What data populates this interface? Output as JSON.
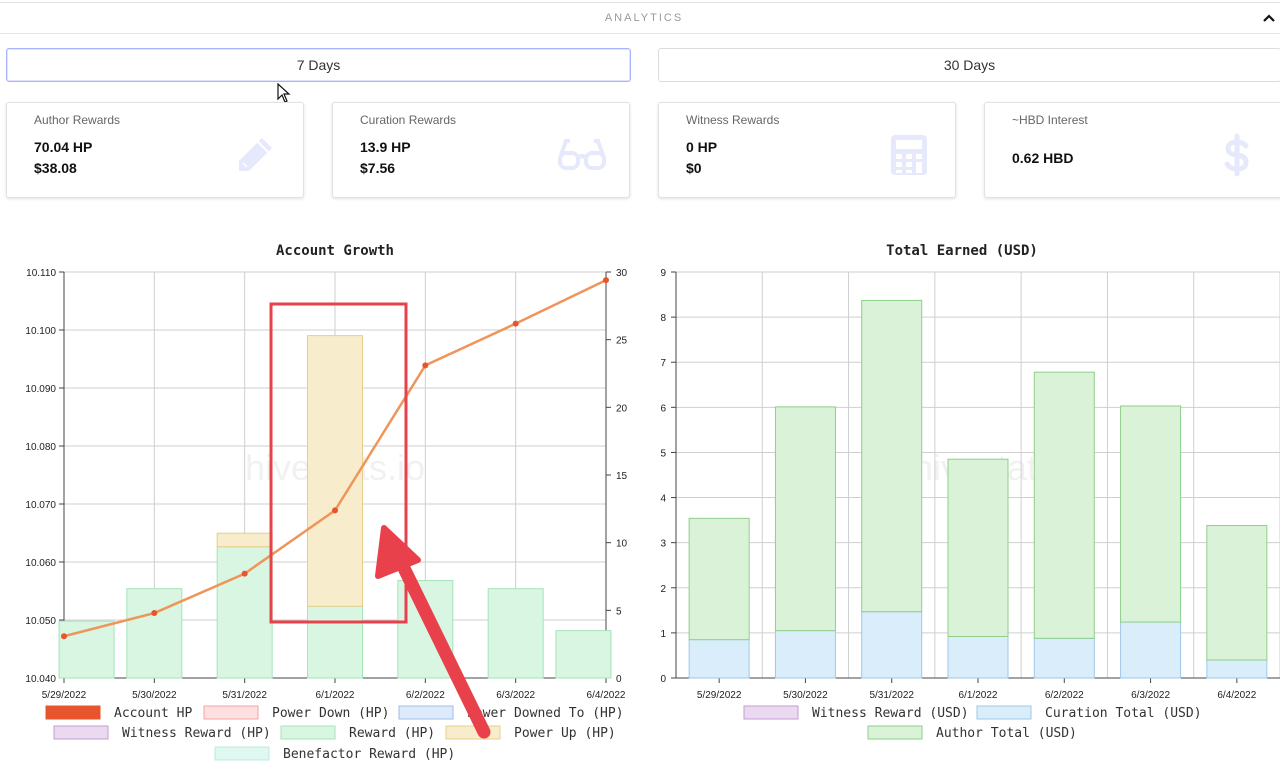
{
  "section": {
    "title": "ANALYTICS"
  },
  "periods": [
    {
      "label": "7 Days",
      "active": true
    },
    {
      "label": "30 Days",
      "active": false
    }
  ],
  "cards": [
    {
      "title": "Author Rewards",
      "v1": "70.04 HP",
      "v2": "$38.08",
      "icon": "pencil-icon"
    },
    {
      "title": "Curation Rewards",
      "v1": "13.9 HP",
      "v2": "$7.56",
      "icon": "glasses-icon"
    },
    {
      "title": "Witness Rewards",
      "v1": "0 HP",
      "v2": "$0",
      "icon": "calculator-icon"
    },
    {
      "title": "~HBD Interest",
      "v1": "0.62 HBD",
      "icon": "dollar-icon"
    }
  ],
  "colors": {
    "accent_border": "#a9b4ff",
    "account_hp": "#e8542b",
    "line": "#f0955a",
    "reward_fill": "#d8f6e2",
    "reward_stroke": "#a6e3b8",
    "powerup_fill": "#f7eccb",
    "powerup_stroke": "#e5cf8c",
    "curation_fill": "#d9eefa",
    "curation_stroke": "#9fc7e6",
    "author_fill": "#daf3d8",
    "author_stroke": "#8fcf8a",
    "highlight": "#e8414b"
  },
  "watermark": "hivestats.io",
  "chart_data": [
    {
      "type": "bar",
      "title": "Account Growth",
      "categories": [
        "5/29/2022",
        "5/30/2022",
        "5/31/2022",
        "6/1/2022",
        "6/2/2022",
        "6/3/2022",
        "6/4/2022"
      ],
      "y_left": {
        "ticks": [
          "10.040",
          "10.050",
          "10.060",
          "10.070",
          "10.080",
          "10.090",
          "10.100",
          "10.110"
        ],
        "ylim": [
          10.04,
          10.11
        ]
      },
      "y_right": {
        "ticks": [
          "0",
          "5",
          "10",
          "15",
          "20",
          "25",
          "30"
        ],
        "ylim": [
          0,
          30
        ]
      },
      "series": [
        {
          "name": "Account HP",
          "type": "line",
          "axis": "left",
          "values": [
            10.0472,
            10.0512,
            10.058,
            10.0689,
            10.0939,
            10.1011,
            10.1086
          ]
        },
        {
          "name": "Power Down (HP)",
          "type": "bar",
          "axis": "right",
          "values": [
            0,
            0,
            0,
            0,
            0,
            0,
            0
          ]
        },
        {
          "name": "Power Downed To (HP)",
          "type": "bar",
          "axis": "right",
          "values": [
            0,
            0,
            0,
            0,
            0,
            0,
            0
          ]
        },
        {
          "name": "Witness Reward (HP)",
          "type": "bar",
          "axis": "right",
          "values": [
            0,
            0,
            0,
            0,
            0,
            0,
            0
          ]
        },
        {
          "name": "Reward (HP)",
          "type": "bar",
          "axis": "right",
          "values": [
            4.2,
            6.6,
            9.7,
            5.3,
            7.2,
            6.6,
            3.5
          ]
        },
        {
          "name": "Power Up (HP)",
          "type": "bar",
          "axis": "right",
          "values": [
            0,
            0,
            1.0,
            20.0,
            0,
            0,
            0
          ]
        },
        {
          "name": "Benefactor Reward (HP)",
          "type": "bar",
          "axis": "right",
          "values": [
            0,
            0,
            0,
            0,
            0,
            0,
            0
          ]
        }
      ]
    },
    {
      "type": "bar",
      "title": "Total Earned (USD)",
      "categories": [
        "5/29/2022",
        "5/30/2022",
        "5/31/2022",
        "6/1/2022",
        "6/2/2022",
        "6/3/2022",
        "6/4/2022"
      ],
      "y_left": {
        "ticks": [
          "0",
          "1",
          "2",
          "3",
          "4",
          "5",
          "6",
          "7",
          "8",
          "9"
        ],
        "ylim": [
          0,
          9
        ]
      },
      "series": [
        {
          "name": "Witness Reward (USD)",
          "values": [
            0,
            0,
            0,
            0,
            0,
            0,
            0
          ]
        },
        {
          "name": "Curation Total (USD)",
          "values": [
            0.85,
            1.05,
            1.47,
            0.92,
            0.88,
            1.24,
            0.4
          ]
        },
        {
          "name": "Author Total (USD)",
          "values": [
            2.69,
            4.96,
            6.9,
            3.93,
            5.9,
            4.79,
            2.98
          ]
        }
      ]
    }
  ]
}
